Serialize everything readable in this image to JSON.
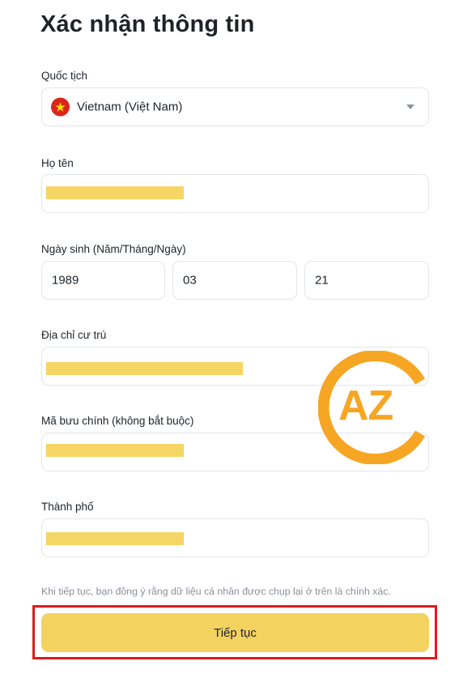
{
  "page": {
    "title": "Xác nhận thông tin"
  },
  "nationality": {
    "label": "Quốc tịch",
    "value": "Vietnam (Việt Nam)",
    "flag_icon": "vietnam-flag-icon",
    "dropdown_icon": "caret-down-icon"
  },
  "full_name": {
    "label": "Họ tên",
    "value": ""
  },
  "birth_date": {
    "label": "Ngày sinh (Năm/Tháng/Ngày)",
    "year": "1989",
    "month": "03",
    "day": "21"
  },
  "address": {
    "label": "Địa chỉ cư trú",
    "value": ""
  },
  "postal_code": {
    "label": "Mã bưu chính (không bắt buộc)",
    "value": ""
  },
  "city": {
    "label": "Thành phố",
    "value": ""
  },
  "consent_text": "Khi tiếp tục, bạn đồng ý rằng dữ liệu cá nhân được chụp lại ở trên là chính xác.",
  "continue_button": {
    "label": "Tiếp tục"
  },
  "watermark": {
    "text": "AZ"
  },
  "colors": {
    "accent": "#f4d25f",
    "redaction": "#f5d563",
    "highlight": "#e01b1b",
    "watermark": "#f6a623"
  }
}
